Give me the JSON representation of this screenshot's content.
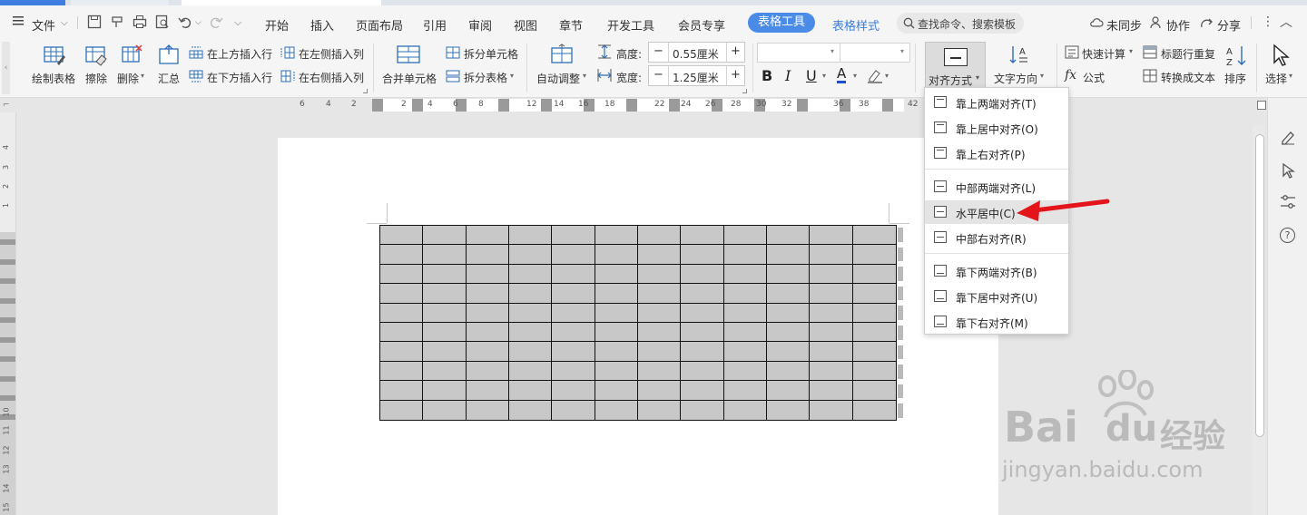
{
  "menubar": {
    "file_label": "文件",
    "tabs": [
      "开始",
      "插入",
      "页面布局",
      "引用",
      "审阅",
      "视图",
      "章节",
      "开发工具",
      "会员专享"
    ],
    "active_tab": "表格工具",
    "style_tab": "表格样式",
    "search_placeholder": "查找命令、搜索模板",
    "sync_label": "未同步",
    "collab_label": "协作",
    "share_label": "分享"
  },
  "ribbon": {
    "draw_table": "绘制表格",
    "erase": "擦除",
    "delete": "删除",
    "summary": "汇总",
    "insert_above": "在上方插入行",
    "insert_below": "在下方插入行",
    "insert_left": "在左侧插入列",
    "insert_right": "在右侧插入列",
    "merge_cells": "合并单元格",
    "split_cells": "拆分单元格",
    "split_table": "拆分表格",
    "auto_fit": "自动调整",
    "height_label": "高度:",
    "height_value": "0.55厘米",
    "width_label": "宽度:",
    "width_value": "1.25厘米",
    "align_label": "对齐方式",
    "text_direction": "文字方向",
    "quick_calc": "快速计算",
    "repeat_header": "标题行重复",
    "formula": "公式",
    "convert_text": "转换成文本",
    "sort": "排序",
    "select": "选择",
    "bold": "B",
    "italic": "I",
    "underline": "U",
    "font_color_glyph": "A"
  },
  "ruler": {
    "left_numbers": [
      "6",
      "4",
      "2"
    ],
    "numbers": [
      "2",
      "4",
      "6",
      "8",
      "12",
      "14",
      "16",
      "18",
      "22",
      "24",
      "26",
      "28",
      "30",
      "32",
      "36",
      "38",
      "42"
    ]
  },
  "left_ruler": {
    "numbers": [
      "4",
      "3",
      "2",
      "1",
      "10",
      "11",
      "12",
      "13",
      "14",
      "15"
    ]
  },
  "dropdown": {
    "items": [
      {
        "label": "靠上两端对齐(T)",
        "pos": "top"
      },
      {
        "label": "靠上居中对齐(O)",
        "pos": "top"
      },
      {
        "label": "靠上右对齐(P)",
        "pos": "top"
      },
      {
        "label": "中部两端对齐(L)",
        "pos": "mid"
      },
      {
        "label": "水平居中(C)",
        "pos": "mid"
      },
      {
        "label": "中部右对齐(R)",
        "pos": "mid"
      },
      {
        "label": "靠下两端对齐(B)",
        "pos": "bot"
      },
      {
        "label": "靠下居中对齐(U)",
        "pos": "bot"
      },
      {
        "label": "靠下右对齐(M)",
        "pos": "bot"
      }
    ],
    "highlighted_index": 4
  },
  "table": {
    "rows": 10,
    "cols": 12,
    "cell_color": "#c8c8c8"
  },
  "colors": {
    "accent": "#4b8be8",
    "arrow": "#e3141a"
  },
  "watermark": {
    "brand_text": "Bai",
    "brand_text2": "经验",
    "url": "jingyan.baidu.com"
  }
}
